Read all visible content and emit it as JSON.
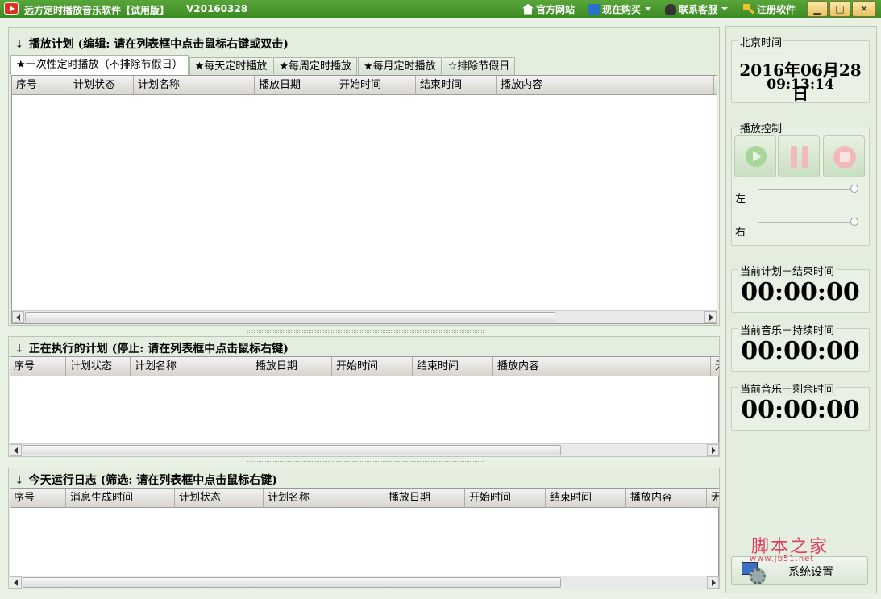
{
  "window": {
    "title": "远方定时播放音乐软件【试用版】",
    "version": "V20160328",
    "menu": [
      {
        "label": "官方网站",
        "icon": "home-icon"
      },
      {
        "label": "现在购买",
        "icon": "cart-icon",
        "dropdown": true
      },
      {
        "label": "联系客服",
        "icon": "user-icon",
        "dropdown": true
      },
      {
        "label": "注册软件",
        "icon": "key-icon"
      }
    ],
    "controls": {
      "minimize": "▁",
      "maximize": "□",
      "close": "✕"
    }
  },
  "plan_panel": {
    "title": "播放计划 (编辑: 请在列表框中点击鼠标右键或双击)",
    "tabs": [
      "★一次性定时播放（不排除节假日）",
      "★每天定时播放",
      "★每周定时播放",
      "★每月定时播放",
      "☆排除节假日"
    ],
    "active_tab": 0,
    "columns": [
      "序号",
      "计划状态",
      "计划名称",
      "播放日期",
      "开始时间",
      "结束时间",
      "播放内容"
    ]
  },
  "running_panel": {
    "title": "正在执行的计划 (停止: 请在列表框中点击鼠标右键)",
    "columns": [
      "序号",
      "计划状态",
      "计划名称",
      "播放日期",
      "开始时间",
      "结束时间",
      "播放内容",
      "无"
    ]
  },
  "log_panel": {
    "title": "今天运行日志 (筛选: 请在列表框中点击鼠标右键)",
    "columns": [
      "序号",
      "消息生成时间",
      "计划状态",
      "计划名称",
      "播放日期",
      "开始时间",
      "结束时间",
      "播放内容",
      "无"
    ]
  },
  "sidebar": {
    "clock": {
      "title": "北京时间",
      "date": "2016年06月28日",
      "time": "09:13:14"
    },
    "playback": {
      "title": "播放控制",
      "left_label": "左",
      "right_label": "右",
      "left_level": 1.0,
      "right_level": 1.0
    },
    "plan_end": {
      "title": "当前计划－结束时间",
      "value": "00:00:00"
    },
    "music_elapsed": {
      "title": "当前音乐－持续时间",
      "value": "00:00:00"
    },
    "music_remaining": {
      "title": "当前音乐－剩余时间",
      "value": "00:00:00"
    },
    "settings_label": "系统设置"
  },
  "watermark": {
    "text": "脚本之家",
    "url": "www.jb51.net"
  },
  "colors": {
    "titlebar": "#4a9a30",
    "panel_bg": "#e4eedf",
    "grid_bg": "#ffffff"
  }
}
